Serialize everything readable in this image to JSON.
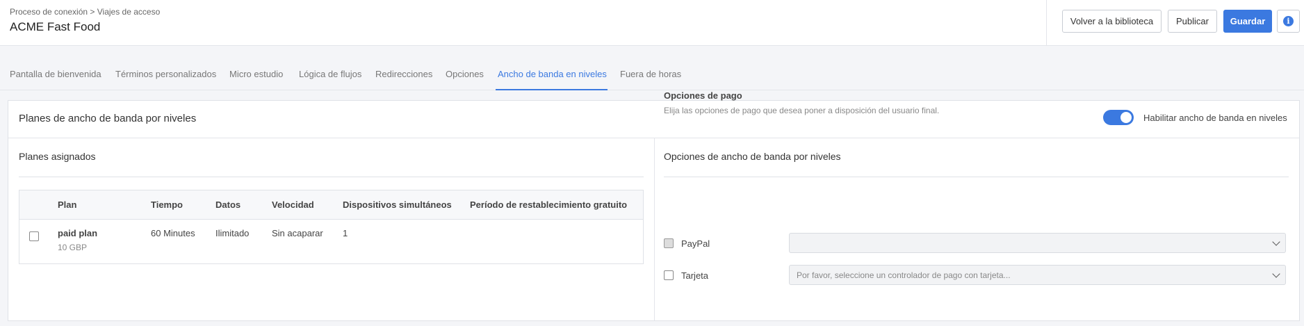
{
  "header": {
    "breadcrumb": "Proceso de conexión > Viajes de acceso",
    "title": "ACME Fast Food",
    "buttons": {
      "back": "Volver a la biblioteca",
      "publish": "Publicar",
      "save": "Guardar",
      "info_glyph": "i"
    }
  },
  "tabs": [
    {
      "label": "Pantalla de bienvenida"
    },
    {
      "label": "Términos personalizados"
    },
    {
      "label": "Micro estudio"
    },
    {
      "label": "Lógica de flujos"
    },
    {
      "label": "Redirecciones"
    },
    {
      "label": "Opciones"
    },
    {
      "label": "Ancho de banda en niveles"
    },
    {
      "label": "Fuera de horas"
    }
  ],
  "active_tab": "Ancho de banda en niveles",
  "card": {
    "title": "Planes de ancho de banda por niveles",
    "toggle_label": "Habilitar ancho de banda en niveles",
    "toggle_on": true
  },
  "plans": {
    "title": "Planes asignados",
    "columns": [
      "Plan",
      "Tiempo",
      "Datos",
      "Velocidad",
      "Dispositivos simultáneos",
      "Período de restablecimiento gratuito"
    ],
    "rows": [
      {
        "plan": "paid plan",
        "price": "10 GBP",
        "time": "60 Minutes",
        "data": "Ilimitado",
        "speed": "Sin acaparar",
        "devices": "1",
        "reset_period": ""
      }
    ]
  },
  "options": {
    "title": "Opciones de ancho de banda por niveles",
    "payment_heading": "Opciones de pago",
    "payment_desc": "Elija las opciones de pago que desea poner a disposición del usuario final.",
    "methods": [
      {
        "label": "PayPal",
        "select_value": "",
        "disabled": true
      },
      {
        "label": "Tarjeta",
        "select_value": "Por favor, seleccione un controlador de pago con tarjeta...",
        "disabled": false
      }
    ]
  },
  "colors": {
    "accent": "#3b79e0"
  }
}
